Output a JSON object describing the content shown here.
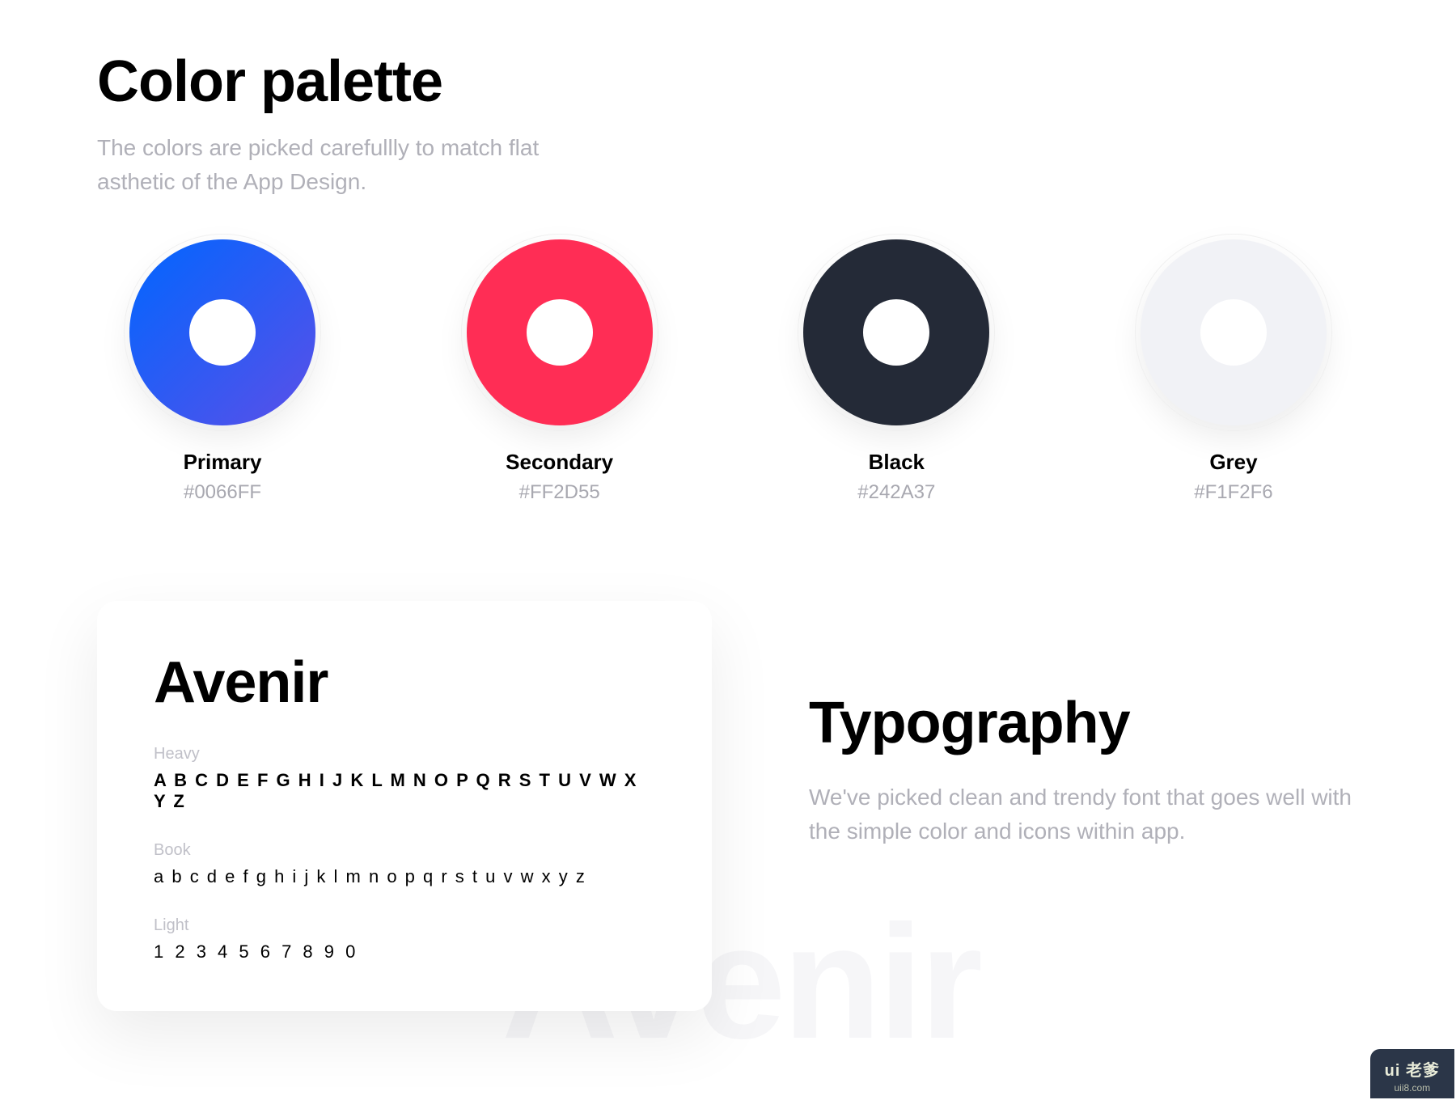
{
  "palette": {
    "title": "Color palette",
    "description": "The colors are picked carefullly to match flat asthetic of the App Design.",
    "swatches": [
      {
        "label": "Primary",
        "hex": "#0066FF"
      },
      {
        "label": "Secondary",
        "hex": "#FF2D55"
      },
      {
        "label": "Black",
        "hex": "#242A37"
      },
      {
        "label": "Grey",
        "hex": "#F1F2F6"
      }
    ]
  },
  "typography": {
    "font_name": "Avenir",
    "weights": [
      {
        "label": "Heavy",
        "sample": "A B C D E F G H I J K L M N O P Q R S T U V W X Y Z"
      },
      {
        "label": "Book",
        "sample": "a b c d e f g h i j k l m n o p q r s t u v w x y z"
      },
      {
        "label": "Light",
        "sample": "1 2 3 4 5 6 7 8 9 0"
      }
    ],
    "title": "Typography",
    "description": "We've picked clean and trendy font that goes well with the simple color and icons within app.",
    "watermark": "Avenir"
  },
  "badge": {
    "main": "ui 老爹",
    "sub": "uii8.com"
  }
}
